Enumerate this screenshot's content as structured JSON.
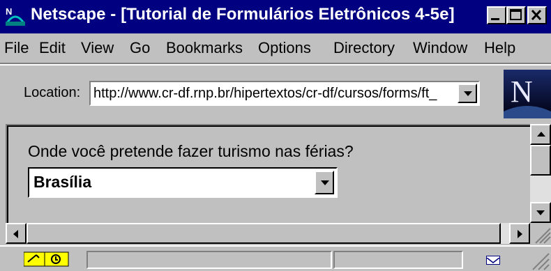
{
  "window": {
    "title": "Netscape - [Tutorial de Formulários Eletrônicos 4-5e]",
    "title_bar_color": "#000080"
  },
  "menu": {
    "items": [
      {
        "label": "File"
      },
      {
        "label": "Edit"
      },
      {
        "label": "View"
      },
      {
        "label": "Go"
      },
      {
        "label": "Bookmarks"
      },
      {
        "label": "Options"
      },
      {
        "label": "Directory"
      },
      {
        "label": "Window"
      },
      {
        "label": "Help"
      }
    ]
  },
  "location": {
    "label": "Location:",
    "url": "http://www.cr-df.rnp.br/hipertextos/cr-df/cursos/forms/ft_"
  },
  "logo": {
    "letter": "N",
    "icon": "netscape-logo"
  },
  "form": {
    "question": "Onde você pretende fazer turismo nas férias?",
    "selected_option": "Brasília"
  },
  "icons": {
    "window": "netscape-app-icon",
    "minimize": "minimize-icon",
    "maximize": "maximize-icon",
    "close": "close-icon",
    "status_security": "security-key-icon",
    "status_mail": "mail-icon"
  }
}
